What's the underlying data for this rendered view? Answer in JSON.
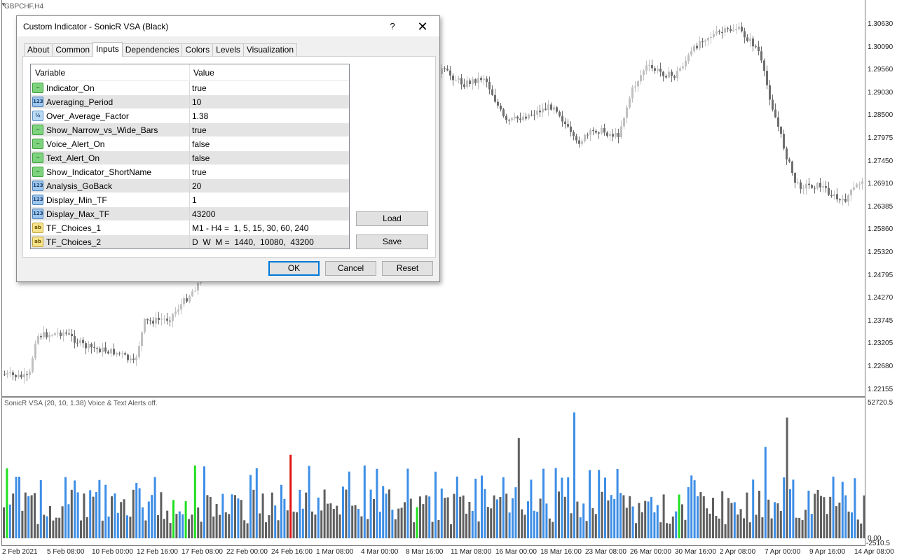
{
  "chart": {
    "symbol": "GBPCHF,H4",
    "price_labels": [
      "1.30630",
      "1.30090",
      "1.29560",
      "1.29030",
      "1.28500",
      "1.27975",
      "1.27450",
      "1.26910",
      "1.26385",
      "1.25860",
      "1.25320",
      "1.24795",
      "1.24270",
      "1.23745",
      "1.23205",
      "1.22680",
      "1.22155"
    ],
    "indicator_caption": "SonicR VSA  (20, 10, 1.38)   Voice & Text Alerts off.",
    "volume_max_label": "52720.5",
    "volume_zero_label": "0.00",
    "volume_min_label": "-2510.5",
    "time_labels": [
      "2 Feb 2021",
      "5 Feb 08:00",
      "10 Feb 00:00",
      "12 Feb 16:00",
      "17 Feb 08:00",
      "22 Feb 00:00",
      "24 Feb 16:00",
      "1 Mar 08:00",
      "4 Mar 00:00",
      "8 Mar 16:00",
      "11 Mar 08:00",
      "16 Mar 00:00",
      "18 Mar 16:00",
      "23 Mar 08:00",
      "26 Mar 00:00",
      "30 Mar 16:00",
      "2 Apr 08:00",
      "7 Apr 00:00",
      "9 Apr 16:00",
      "14 Apr 08:00"
    ],
    "colors": {
      "bull_candle": "#c0c0c0",
      "bear_candle": "#6e6e6e",
      "vol_blue": "#3d8ee6",
      "vol_gray": "#5f5f5f",
      "vol_green": "#1fe01f",
      "vol_red": "#e01414"
    }
  },
  "dialog": {
    "title": "Custom Indicator - SonicR VSA (Black)",
    "help_label": "?",
    "close_label": "✕",
    "tabs": [
      {
        "label": "About"
      },
      {
        "label": "Common"
      },
      {
        "label": "Inputs"
      },
      {
        "label": "Dependencies"
      },
      {
        "label": "Colors"
      },
      {
        "label": "Levels"
      },
      {
        "label": "Visualization"
      }
    ],
    "active_tab": "Inputs",
    "table": {
      "col_variable": "Variable",
      "col_value": "Value",
      "rows": [
        {
          "icon": "bool-icon",
          "icon_text": "~",
          "name": "Indicator_On",
          "value": "true"
        },
        {
          "icon": "int-icon",
          "icon_text": "123",
          "name": "Averaging_Period",
          "value": "10"
        },
        {
          "icon": "double-icon",
          "icon_text": "½",
          "name": "Over_Average_Factor",
          "value": "1.38"
        },
        {
          "icon": "bool-icon",
          "icon_text": "~",
          "name": "Show_Narrow_vs_Wide_Bars",
          "value": "true"
        },
        {
          "icon": "bool-icon",
          "icon_text": "~",
          "name": "Voice_Alert_On",
          "value": "false"
        },
        {
          "icon": "bool-icon",
          "icon_text": "~",
          "name": "Text_Alert_On",
          "value": "false"
        },
        {
          "icon": "bool-icon",
          "icon_text": "~",
          "name": "Show_Indicator_ShortName",
          "value": "true"
        },
        {
          "icon": "int-icon",
          "icon_text": "123",
          "name": "Analysis_GoBack",
          "value": "20"
        },
        {
          "icon": "int-icon",
          "icon_text": "123",
          "name": "Display_Min_TF",
          "value": "1"
        },
        {
          "icon": "int-icon",
          "icon_text": "123",
          "name": "Display_Max_TF",
          "value": "43200"
        },
        {
          "icon": "string-icon",
          "icon_text": "ab",
          "name": "TF_Choices_1",
          "value": "M1 - H4 =  1, 5, 15, 30, 60, 240"
        },
        {
          "icon": "string-icon",
          "icon_text": "ab",
          "name": "TF_Choices_2",
          "value": "D  W  M =  1440,  10080,  43200"
        }
      ]
    },
    "buttons": {
      "load": "Load",
      "save": "Save",
      "ok": "OK",
      "cancel": "Cancel",
      "reset": "Reset"
    }
  }
}
